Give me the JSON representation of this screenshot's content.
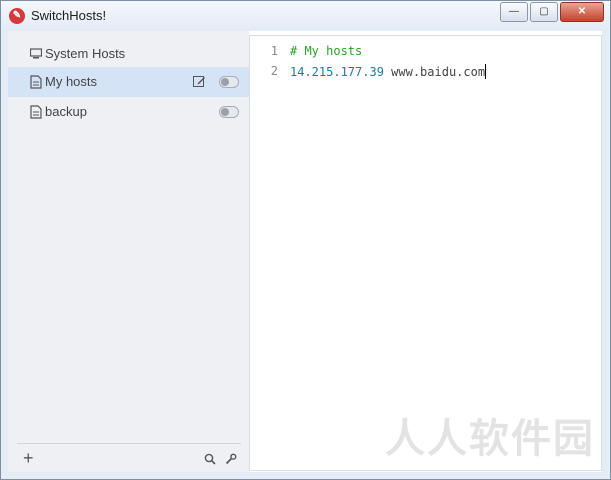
{
  "window": {
    "title": "SwitchHosts!",
    "minimize": "—",
    "maximize": "▢",
    "close": "✕"
  },
  "sidebar": {
    "items": [
      {
        "label": "System Hosts"
      },
      {
        "label": "My hosts"
      },
      {
        "label": "backup"
      }
    ],
    "add_label": "+"
  },
  "editor": {
    "lines": [
      {
        "number": "1",
        "comment": "# My hosts"
      },
      {
        "number": "2",
        "ip": "14.215.177.39",
        "host": " www.baidu.com"
      }
    ]
  },
  "watermark": "人人软件园"
}
